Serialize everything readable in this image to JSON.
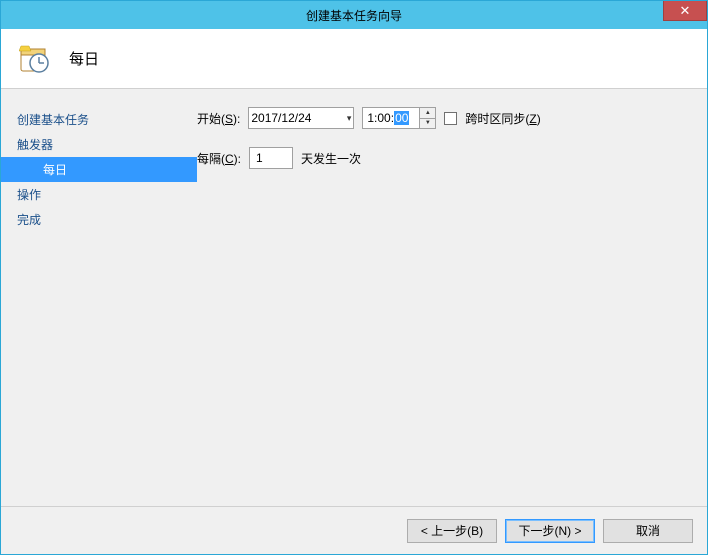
{
  "window": {
    "title": "创建基本任务向导"
  },
  "header": {
    "title": "每日"
  },
  "sidebar": {
    "items": [
      {
        "label": "创建基本任务",
        "sub": false,
        "selected": false
      },
      {
        "label": "触发器",
        "sub": false,
        "selected": false
      },
      {
        "label": "每日",
        "sub": true,
        "selected": true
      },
      {
        "label": "操作",
        "sub": false,
        "selected": false
      },
      {
        "label": "完成",
        "sub": false,
        "selected": false
      }
    ]
  },
  "form": {
    "start_label_pre": "开始(",
    "start_label_key": "S",
    "start_label_post": "):",
    "date_value": "2017/12/24",
    "time_hour_min": "1:00:",
    "time_sec_selected": "00",
    "tz_label_pre": "跨时区同步(",
    "tz_label_key": "Z",
    "tz_label_post": ")",
    "interval_label_pre": "每隔(",
    "interval_label_key": "C",
    "interval_label_post": "):",
    "interval_value": "1",
    "interval_unit": "天发生一次"
  },
  "footer": {
    "back": "< 上一步(B)",
    "next": "下一步(N) >",
    "cancel": "取消"
  }
}
